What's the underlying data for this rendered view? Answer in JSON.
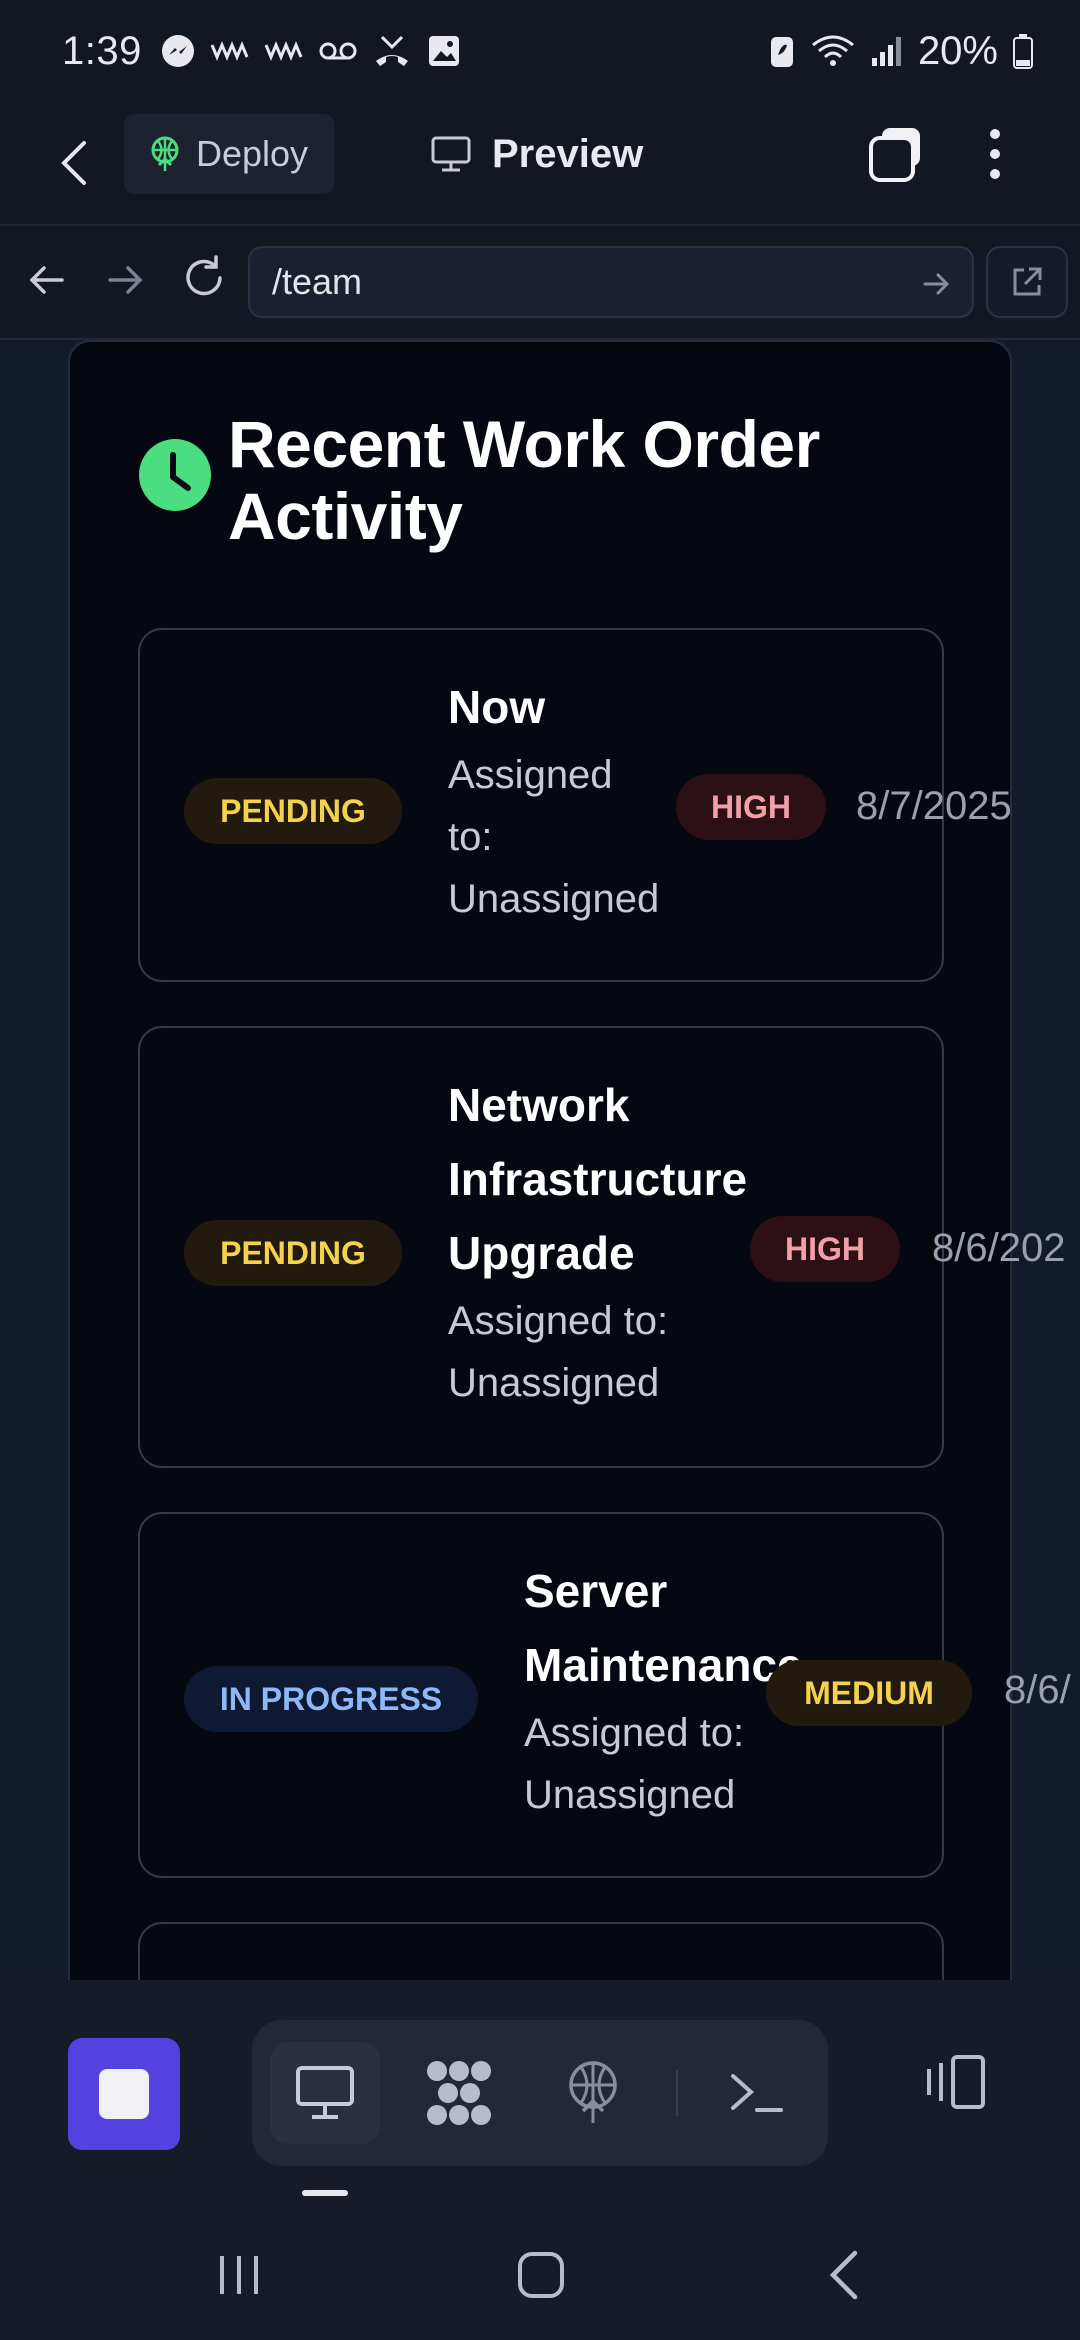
{
  "status_bar": {
    "time": "1:39",
    "battery": "20%"
  },
  "app_bar": {
    "deploy_label": "Deploy",
    "preview_label": "Preview"
  },
  "url_bar": {
    "url": "/team"
  },
  "panel": {
    "title_line1": "Recent Work Order",
    "title_line2": "Activity",
    "work_orders": [
      {
        "status": "PENDING",
        "title_lines": [
          "Now"
        ],
        "assign_lines": [
          "Assigned",
          "to:",
          "Unassigned"
        ],
        "priority": "HIGH",
        "date": "8/7/2025"
      },
      {
        "status": "PENDING",
        "title_lines": [
          "Network",
          "Infrastructure",
          "Upgrade"
        ],
        "assign_lines": [
          "Assigned to:",
          "Unassigned"
        ],
        "priority": "HIGH",
        "date": "8/6/202"
      },
      {
        "status": "IN PROGRESS",
        "title_lines": [
          "Server",
          "Maintenance"
        ],
        "assign_lines": [
          "Assigned to:",
          "Unassigned"
        ],
        "priority": "MEDIUM",
        "date": "8/6/"
      }
    ]
  },
  "colors": {
    "accent_purple": "#5540e0",
    "clock_green": "#4ade80",
    "pending_text": "#f4d24d",
    "progress_text": "#8fb9f6",
    "high_text": "#f2a0a8"
  }
}
